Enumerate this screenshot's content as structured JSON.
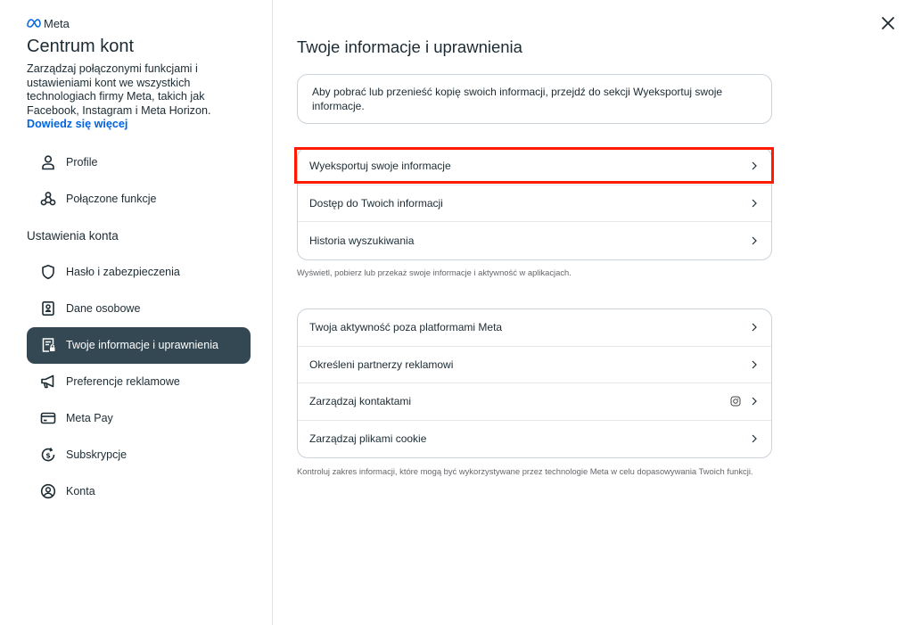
{
  "brand": {
    "logo_text": "Meta"
  },
  "sidebar": {
    "title": "Centrum kont",
    "description": "Zarządzaj połączonymi funkcjami i ustawieniami kont we wszystkich technologiach firmy Meta, takich jak Facebook, Instagram i Meta Horizon.",
    "learn_more": "Dowiedz się więcej",
    "items_top": [
      {
        "label": "Profile",
        "icon": "person-icon"
      },
      {
        "label": "Połączone funkcje",
        "icon": "connected-nodes-icon"
      }
    ],
    "section_label": "Ustawienia konta",
    "items_settings": [
      {
        "label": "Hasło i zabezpieczenia",
        "icon": "shield-icon"
      },
      {
        "label": "Dane osobowe",
        "icon": "id-card-icon"
      },
      {
        "label": "Twoje informacje i uprawnienia",
        "icon": "document-lock-icon",
        "active": true
      },
      {
        "label": "Preferencje reklamowe",
        "icon": "megaphone-icon"
      },
      {
        "label": "Meta Pay",
        "icon": "credit-card-icon"
      },
      {
        "label": "Subskrypcje",
        "icon": "subscription-icon"
      },
      {
        "label": "Konta",
        "icon": "account-circle-icon"
      }
    ]
  },
  "main": {
    "title": "Twoje informacje i uprawnienia",
    "info_text": "Aby pobrać lub przenieść kopię swoich informacji, przejdź do sekcji Wyeksportuj swoje informacje.",
    "group1": [
      {
        "label": "Wyeksportuj swoje informacje"
      },
      {
        "label": "Dostęp do Twoich informacji"
      },
      {
        "label": "Historia wyszukiwania"
      }
    ],
    "group1_note": "Wyświetl, pobierz lub przekaż swoje informacje i aktywność w aplikacjach.",
    "group2": [
      {
        "label": "Twoja aktywność poza platformami Meta"
      },
      {
        "label": "Określeni partnerzy reklamowi"
      },
      {
        "label": "Zarządzaj kontaktami",
        "extra_icon": "instagram-icon"
      },
      {
        "label": "Zarządzaj plikami cookie"
      }
    ],
    "group2_note": "Kontroluj zakres informacji, które mogą być wykorzystywane przez technologie Meta w celu dopasowywania Twoich funkcji."
  },
  "colors": {
    "active_bg": "#344854",
    "link": "#0064e0",
    "highlight": "#ff1a00",
    "text": "#1c2b33",
    "muted": "#65676b"
  }
}
